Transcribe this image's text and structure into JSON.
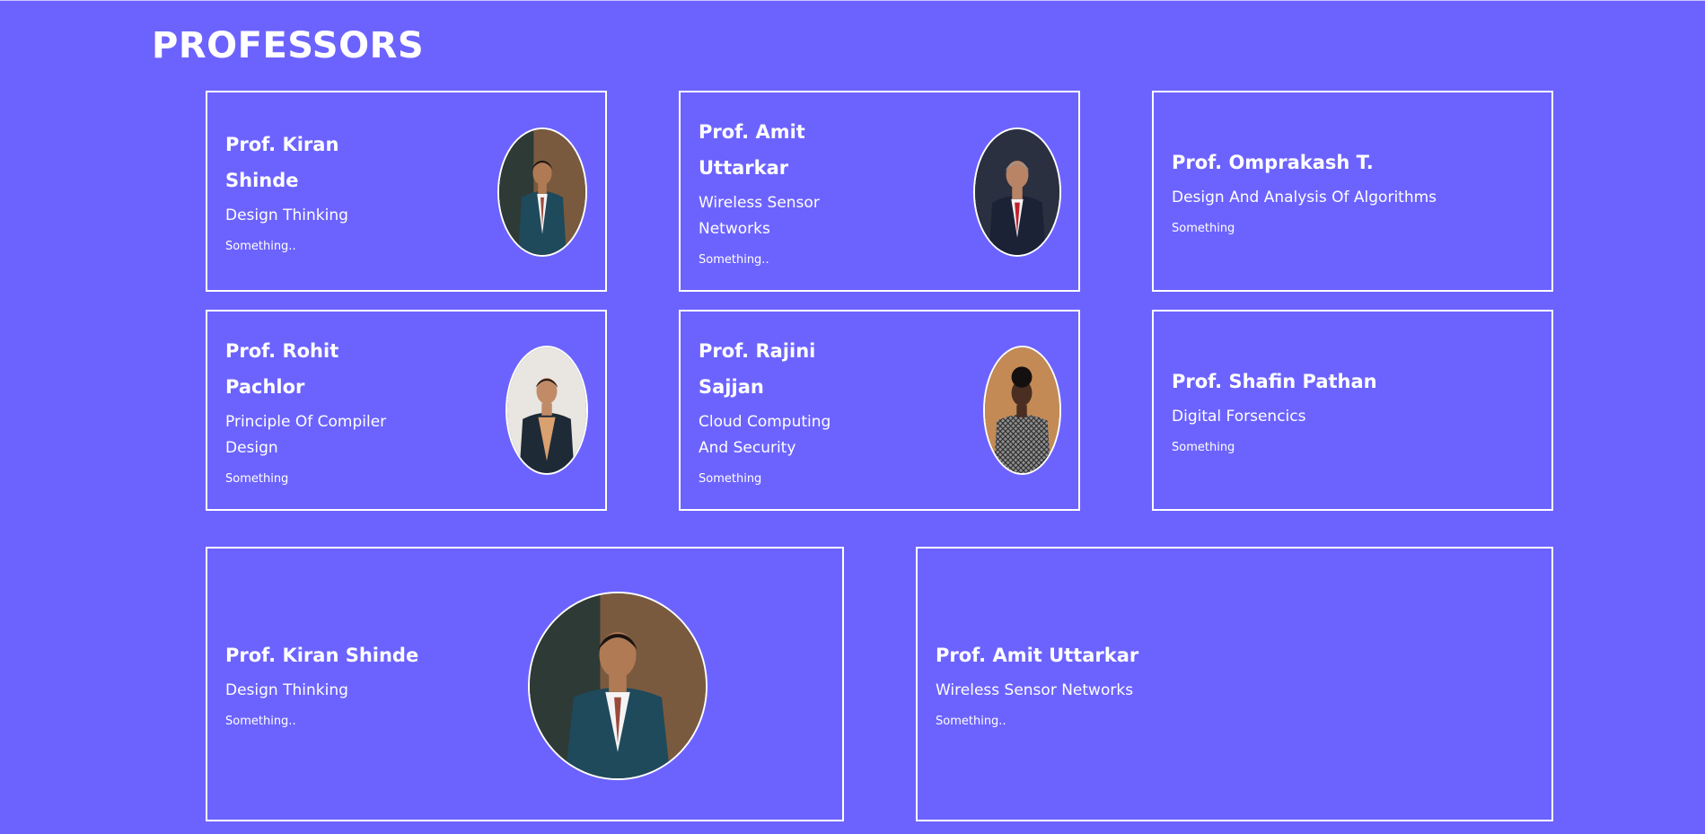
{
  "page": {
    "title": "PROFESSORS"
  },
  "professors": [
    {
      "name": "Prof. Kiran Shinde",
      "subject": "Design Thinking",
      "note": "Something..",
      "photo": "professor-kiran-photo"
    },
    {
      "name": "Prof. Amit Uttarkar",
      "subject": "Wireless Sensor Networks",
      "note": "Something..",
      "photo": "professor-amit-photo"
    },
    {
      "name": "Prof. Omprakash T.",
      "subject": "Design And Analysis Of Algorithms",
      "note": "Something"
    },
    {
      "name": "Prof. Rohit Pachlor",
      "subject": "Principle Of Compiler Design",
      "note": "Something",
      "photo": "professor-rohit-photo"
    },
    {
      "name": "Prof. Rajini Sajjan",
      "subject": "Cloud Computing And Security",
      "note": "Something",
      "photo": "professor-rajini-photo"
    },
    {
      "name": "Prof. Shafin Pathan",
      "subject": "Digital Forsencics",
      "note": "Something"
    }
  ],
  "featured": [
    {
      "name": "Prof. Kiran Shinde",
      "subject": "Design Thinking",
      "note": "Something..",
      "photo": "professor-kiran-photo"
    },
    {
      "name": "Prof. Amit Uttarkar",
      "subject": "Wireless Sensor Networks",
      "note": "Something.."
    }
  ]
}
